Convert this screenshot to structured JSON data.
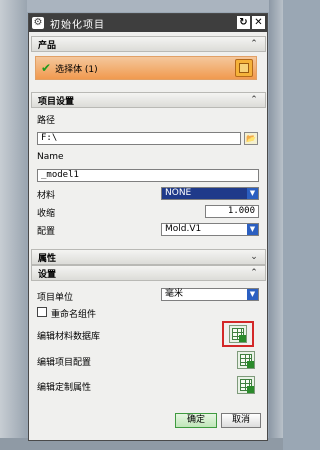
{
  "window": {
    "title": "初始化项目",
    "gear_glyph": "⚙",
    "rollup_glyph": "↻",
    "close_glyph": "✕"
  },
  "sections": {
    "product": {
      "label": "产品",
      "expanded": true
    },
    "project_settings": {
      "label": "项目设置",
      "expanded": true
    },
    "attributes": {
      "label": "属性",
      "expanded": false
    },
    "settings": {
      "label": "设置",
      "expanded": true
    }
  },
  "product": {
    "select_body_label": "选择体 (1)",
    "check_glyph": "✔"
  },
  "project_settings": {
    "path_label": "路径",
    "path_value": "F:\\",
    "name_label": "Name",
    "name_value": "_model1",
    "material_label": "材料",
    "material_value": "NONE",
    "shrink_label": "收缩",
    "shrink_value": "1.000",
    "config_label": "配置",
    "config_value": "Mold.V1"
  },
  "settings": {
    "project_units_label": "项目单位",
    "project_units_value": "毫米",
    "rename_components_label": "重命名组件",
    "rename_components_checked": false,
    "edit_material_db_label": "编辑材料数据库",
    "edit_project_config_label": "编辑项目配置",
    "edit_custom_attr_label": "编辑定制属性"
  },
  "buttons": {
    "ok": "确定",
    "cancel": "取消"
  },
  "colors": {
    "selection_highlight": "#f19a4f",
    "dropdown_dark": "#1f3a8a",
    "highlight_box": "#d32828",
    "ok_button": "#bfe6b8"
  }
}
